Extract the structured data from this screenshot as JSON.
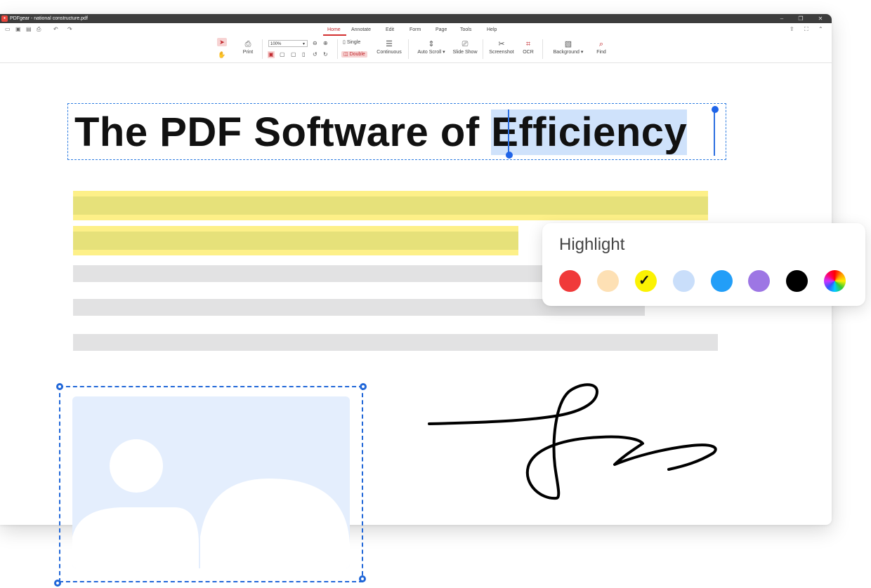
{
  "window": {
    "title": "PDFgear - national constructure.pdf",
    "logo_text": "gear"
  },
  "menu": [
    "Home",
    "Annotate",
    "Edit",
    "Form",
    "Page",
    "Tools",
    "Help"
  ],
  "active_menu": "Home",
  "ribbon": {
    "print": "Print",
    "zoom_value": "100%",
    "single": "Single",
    "double": "Double",
    "continuous": "Continuous",
    "auto_scroll": "Auto Scroll ▾",
    "slide_show": "Slide Show",
    "screenshot": "Screenshot",
    "ocr": "OCR",
    "background": "Background ▾",
    "find": "Find"
  },
  "document": {
    "heading_plain": "The PDF Software of ",
    "heading_selected": "Efficiency"
  },
  "highlight_popup": {
    "title": "Highlight",
    "colors": [
      {
        "name": "red",
        "hex": "#f03a3a",
        "selected": false
      },
      {
        "name": "peach",
        "hex": "#fde0b4",
        "selected": false
      },
      {
        "name": "yellow",
        "hex": "#fbf203",
        "selected": true
      },
      {
        "name": "light-blue",
        "hex": "#c9defa",
        "selected": false
      },
      {
        "name": "blue",
        "hex": "#229ef8",
        "selected": false
      },
      {
        "name": "purple",
        "hex": "#9d76e4",
        "selected": false
      },
      {
        "name": "black",
        "hex": "#000000",
        "selected": false
      },
      {
        "name": "custom-rainbow",
        "hex": "conic",
        "selected": false
      }
    ]
  },
  "colors": {
    "accent": "#1f64e8",
    "highlight": "#e6e17a",
    "titlebar": "#3d3d3d",
    "menu_active": "#c0262b"
  }
}
